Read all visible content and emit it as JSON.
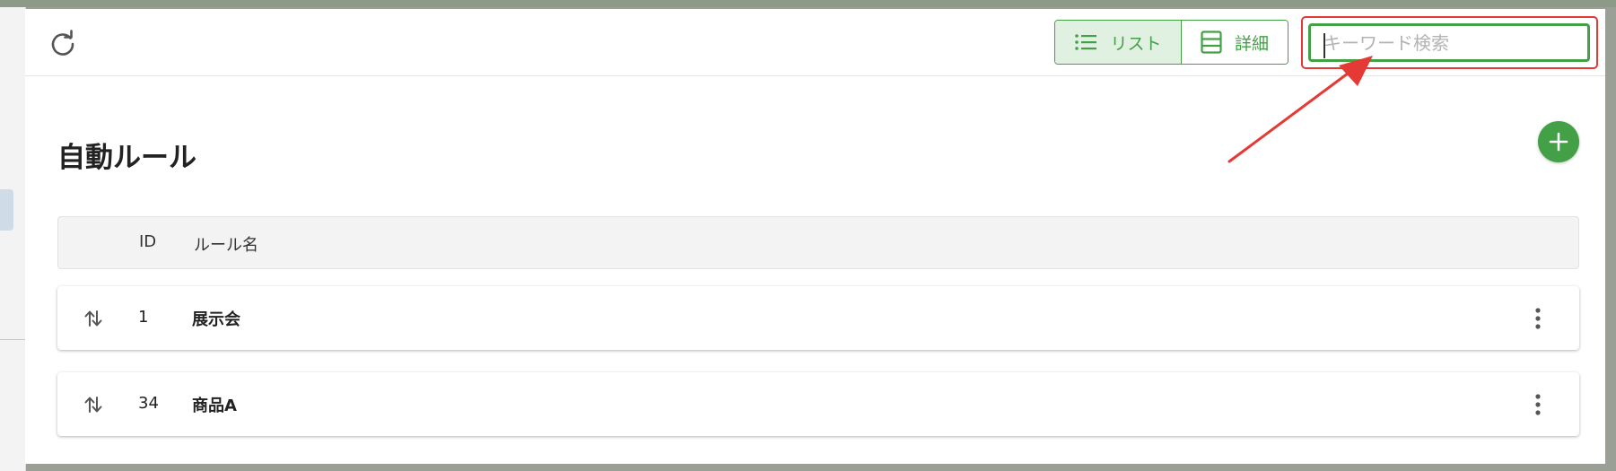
{
  "toolbar": {
    "refresh_icon": "refresh-icon",
    "view_toggle": {
      "list_label": "リスト",
      "list_icon": "list-icon",
      "detail_label": "詳細",
      "detail_icon": "detail-view-icon",
      "selected": "list"
    },
    "search": {
      "placeholder": "キーワード検索",
      "value": ""
    }
  },
  "page": {
    "title": "自動ルール",
    "add_icon": "plus-icon"
  },
  "table": {
    "columns": {
      "id": "ID",
      "name": "ルール名"
    },
    "rows": [
      {
        "id": "1",
        "name": "展示会"
      },
      {
        "id": "34",
        "name": "商品A"
      }
    ]
  },
  "colors": {
    "accent": "#43a047",
    "accent_light": "#e1f1e1",
    "annotation": "#e53935"
  }
}
